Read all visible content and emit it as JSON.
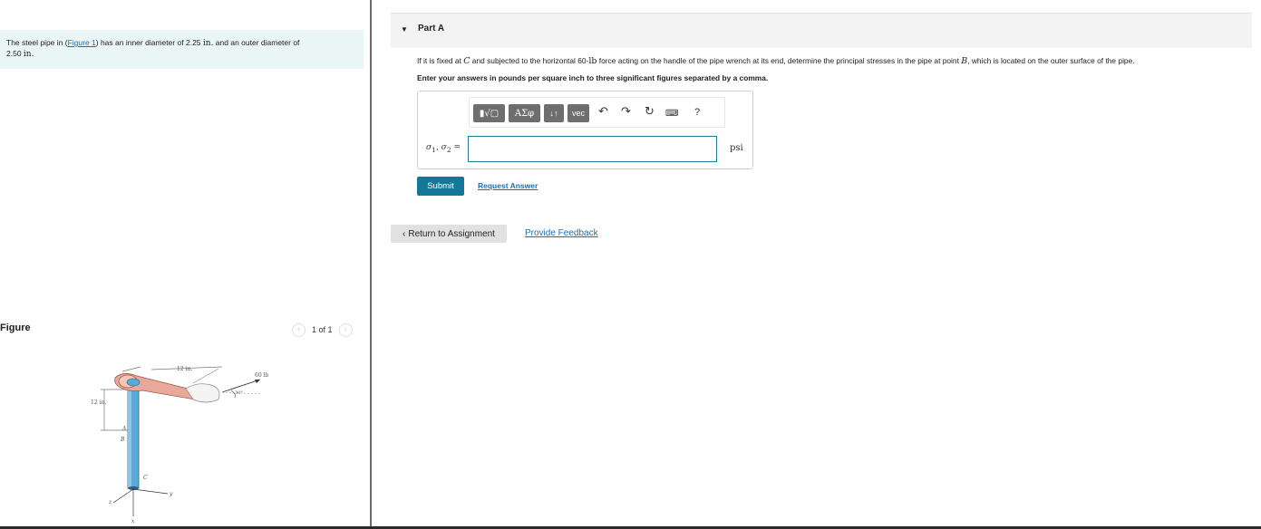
{
  "intro": {
    "text_before_link": "The steel pipe in (",
    "figure_link": "Figure 1",
    "text_after_link": ") has an inner diameter of 2.25 ",
    "unit_in_1": "in.",
    "text_middle": " and an outer diameter of",
    "value_outer": "2.50 ",
    "unit_in_2": "in."
  },
  "figure": {
    "title": "Figure",
    "pager_text": "1 of 1",
    "prev_icon": "chevron-left-icon",
    "next_icon": "chevron-right-icon",
    "labels": {
      "len_top": "12 in.",
      "force": "60 lb",
      "angle": "30°",
      "len_left": "12 in.",
      "point_a": "A",
      "point_b": "B",
      "point_c": "C",
      "axis_y": "y",
      "axis_z": "z",
      "axis_x": "x"
    },
    "colors": {
      "pipe": "#5aa9d6",
      "wrench": "#e8a99a"
    }
  },
  "part": {
    "title": "Part A",
    "caret": "▼",
    "question_1": "If it is fixed at ",
    "question_point_c": "C",
    "question_2": " and subjected to the horizontal 60-",
    "question_unit_lb": "lb",
    "question_3": " force acting on the handle of the pipe wrench at its end, determine the principal stresses in the pipe at point ",
    "question_point_b": "B",
    "question_4": ", which is located on the outer surface of the pipe.",
    "instruction": "Enter your answers in pounds per square inch to three significant figures separated by a comma."
  },
  "toolbar": {
    "btn_templates": "▮√▢",
    "btn_symbols": "ΑΣφ",
    "btn_arrows": "↓↑",
    "btn_vec": "vec",
    "undo_icon": "undo-icon",
    "redo_icon": "redo-icon",
    "reset_icon": "reset-icon",
    "keyboard_icon": "keyboard-icon",
    "help": "?"
  },
  "answer": {
    "label_sigma1": "σ",
    "label_sub1": "1",
    "label_sep": ", ",
    "label_sigma2": "σ",
    "label_sub2": "2",
    "label_eq": " =",
    "value": "",
    "unit": "psi"
  },
  "actions": {
    "submit": "Submit",
    "request_answer": "Request Answer",
    "return": "Return to Assignment",
    "return_icon": "chevron-left-icon",
    "feedback": "Provide Feedback"
  },
  "colors": {
    "accent": "#167899",
    "link": "#1a6fb3",
    "intro_bg": "#eaf5f5",
    "header_bg": "#f3f3f3",
    "input_border": "#1b7e94"
  }
}
